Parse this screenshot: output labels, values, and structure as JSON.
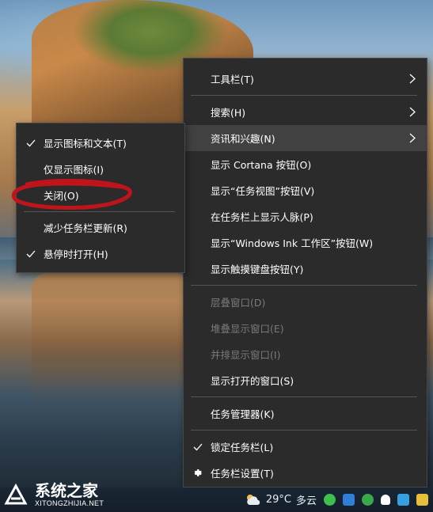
{
  "main_menu": {
    "items": [
      {
        "label": "工具栏(T)",
        "submenu": true
      },
      {
        "label": "搜索(H)",
        "submenu": true
      },
      {
        "label": "资讯和兴趣(N)",
        "submenu": true,
        "hover": true
      },
      {
        "label": "显示 Cortana 按钮(O)"
      },
      {
        "label": "显示“任务视图”按钮(V)"
      },
      {
        "label": "在任务栏上显示人脉(P)"
      },
      {
        "label": "显示“Windows Ink 工作区”按钮(W)"
      },
      {
        "label": "显示触摸键盘按钮(Y)"
      },
      {
        "label": "层叠窗口(D)",
        "disabled": true
      },
      {
        "label": "堆叠显示窗口(E)",
        "disabled": true
      },
      {
        "label": "并排显示窗口(I)",
        "disabled": true
      },
      {
        "label": "显示打开的窗口(S)"
      },
      {
        "label": "任务管理器(K)"
      },
      {
        "label": "锁定任务栏(L)",
        "checked": true
      },
      {
        "label": "任务栏设置(T)",
        "icon": "gear-icon"
      }
    ]
  },
  "sub_menu": {
    "items": [
      {
        "label": "显示图标和文本(T)",
        "checked": true
      },
      {
        "label": "仅显示图标(I)"
      },
      {
        "label": "关闭(O)",
        "annotated": true
      },
      {
        "label": "减少任务栏更新(R)"
      },
      {
        "label": "悬停时打开(H)",
        "checked": true
      }
    ]
  },
  "taskbar": {
    "weather": {
      "temperature": "29°C",
      "condition": "多云",
      "icon": "cloud-sun-icon"
    },
    "tray_icons": [
      "wechat-icon",
      "bluetooth-icon",
      "security-icon",
      "notification-icon",
      "network-icon",
      "app-icon"
    ]
  },
  "watermark": {
    "name": "系统之家",
    "url": "XITONGZHIJIA.NET"
  },
  "colors": {
    "menu_bg": "#2b2b2b",
    "hover_bg": "#414141",
    "separator": "#555555",
    "disabled_text": "#7a7a7a",
    "annotation": "#c0141c"
  }
}
